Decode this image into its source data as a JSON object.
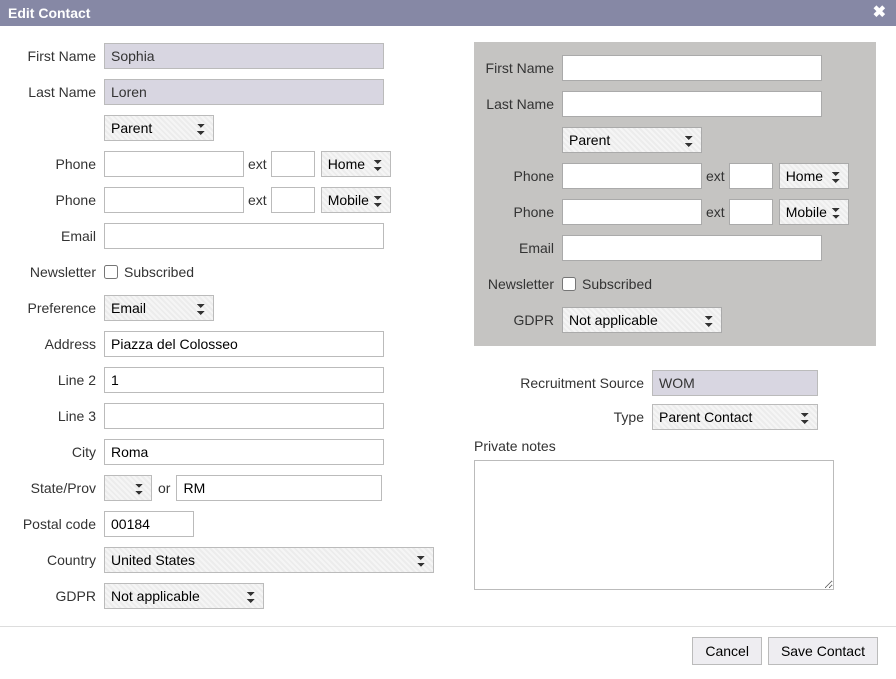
{
  "title": "Edit Contact",
  "left": {
    "labels": {
      "first_name": "First Name",
      "last_name": "Last Name",
      "phone": "Phone",
      "ext": "ext",
      "email": "Email",
      "newsletter": "Newsletter",
      "subscribed": "Subscribed",
      "preference": "Preference",
      "address": "Address",
      "line2": "Line 2",
      "line3": "Line 3",
      "city": "City",
      "state": "State/Prov",
      "or": "or",
      "postal": "Postal code",
      "country": "Country",
      "gdpr": "GDPR"
    },
    "values": {
      "first_name": "Sophia",
      "last_name": "Loren",
      "relationship": "Parent",
      "phone1": "",
      "ext1": "",
      "phonetype1": "Home",
      "phone2": "",
      "ext2": "",
      "phonetype2": "Mobile",
      "email": "",
      "subscribed": false,
      "preference": "Email",
      "address": "Piazza del Colosseo",
      "line2": "1",
      "line3": "",
      "city": "Roma",
      "state_sel": "",
      "state_txt": "RM",
      "postal": "00184",
      "country": "United States",
      "gdpr": "Not applicable"
    }
  },
  "right_panel": {
    "labels": {
      "first_name": "First Name",
      "last_name": "Last Name",
      "phone": "Phone",
      "ext": "ext",
      "email": "Email",
      "newsletter": "Newsletter",
      "subscribed": "Subscribed",
      "gdpr": "GDPR"
    },
    "values": {
      "first_name": "",
      "last_name": "",
      "relationship": "Parent",
      "phone1": "",
      "ext1": "",
      "phonetype1": "Home",
      "phone2": "",
      "ext2": "",
      "phonetype2": "Mobile",
      "email": "",
      "subscribed": false,
      "gdpr": "Not applicable"
    }
  },
  "right_lower": {
    "recruit_label": "Recruitment Source",
    "recruit_value": "WOM",
    "type_label": "Type",
    "type_value": "Parent Contact",
    "notes_label": "Private notes",
    "notes_value": ""
  },
  "footer": {
    "cancel": "Cancel",
    "save": "Save Contact"
  }
}
